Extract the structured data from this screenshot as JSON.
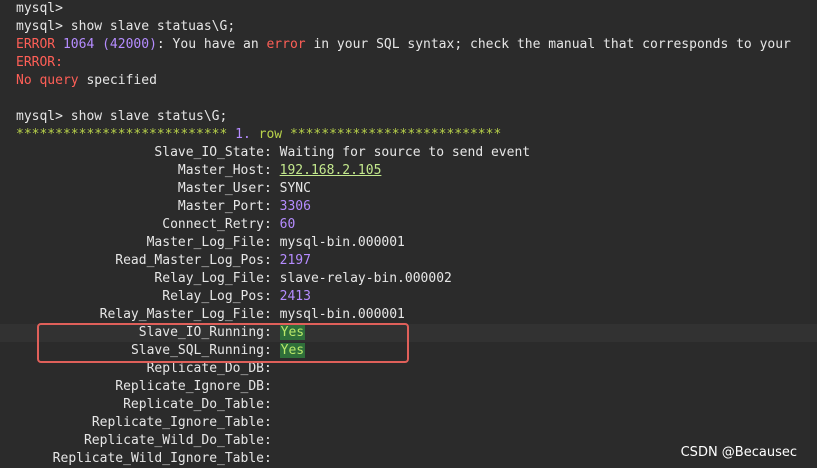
{
  "session": {
    "line1": "mysql>",
    "line2": "mysql> show slave statuas\\G;",
    "error_label": "ERROR",
    "error_code": "1064",
    "error_state": "(42000)",
    "error_msg_a": ": You have an",
    "error_word": "error",
    "error_msg_b": "in your SQL syntax; check the manual that corresponds to your",
    "error2": "ERROR:",
    "noquery_a": "No query",
    "noquery_b": "specified",
    "blank": "",
    "command": "mysql> show slave status\\G;",
    "row_prefix": "*************************** ",
    "row_num": "1.",
    "row_suffix": " row ***************************"
  },
  "fields": [
    {
      "key": "Slave_IO_State",
      "value": "Waiting for source to send event",
      "type": "text"
    },
    {
      "key": "Master_Host",
      "value": "192.168.2.105",
      "type": "ip"
    },
    {
      "key": "Master_User",
      "value": "SYNC",
      "type": "text"
    },
    {
      "key": "Master_Port",
      "value": "3306",
      "type": "num"
    },
    {
      "key": "Connect_Retry",
      "value": "60",
      "type": "num"
    },
    {
      "key": "Master_Log_File",
      "value": "mysql-bin.000001",
      "type": "text"
    },
    {
      "key": "Read_Master_Log_Pos",
      "value": "2197",
      "type": "num"
    },
    {
      "key": "Relay_Log_File",
      "value": "slave-relay-bin.000002",
      "type": "text"
    },
    {
      "key": "Relay_Log_Pos",
      "value": "2413",
      "type": "num"
    },
    {
      "key": "Relay_Master_Log_File",
      "value": "mysql-bin.000001",
      "type": "text"
    },
    {
      "key": "Slave_IO_Running",
      "value": "Yes",
      "type": "yes"
    },
    {
      "key": "Slave_SQL_Running",
      "value": "Yes",
      "type": "yes"
    },
    {
      "key": "Replicate_Do_DB",
      "value": "",
      "type": "text"
    },
    {
      "key": "Replicate_Ignore_DB",
      "value": "",
      "type": "text"
    },
    {
      "key": "Replicate_Do_Table",
      "value": "",
      "type": "text"
    },
    {
      "key": "Replicate_Ignore_Table",
      "value": "",
      "type": "text"
    },
    {
      "key": "Replicate_Wild_Do_Table",
      "value": "",
      "type": "text"
    },
    {
      "key": "Replicate_Wild_Ignore_Table",
      "value": "",
      "type": "text"
    }
  ],
  "watermark": "CSDN @Becausec",
  "colors": {
    "background": "#2b2b2b",
    "error": "#ff5f57",
    "number": "#b58cff",
    "highlight_box": "#e0605a",
    "yes_bg": "#2f6f3a"
  }
}
